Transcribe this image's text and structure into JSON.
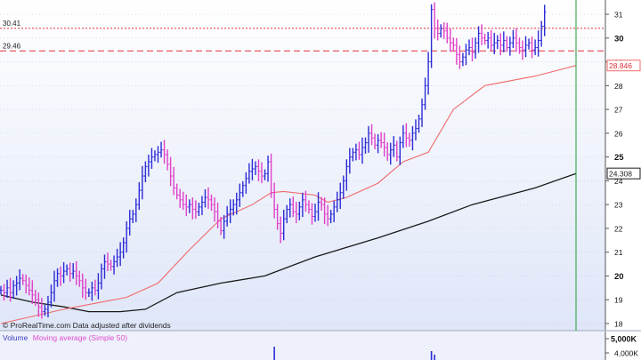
{
  "source_note": "© ProRealTime.com  Data adjusted after dividends",
  "volume_legend": {
    "volume_label": "Volume",
    "ma_label": "Moving average (Simple 50)"
  },
  "colors": {
    "bg_top": "#ffffff",
    "bg_bottom": "#dfe6f8",
    "up": "#2b2bd6",
    "down": "#e040c8",
    "ma50": "#f06a6a",
    "ma200": "#1a1a1a",
    "hline": "#e0303a",
    "cursor": "#1f9a36"
  },
  "chart_data": {
    "type": "candlestick",
    "ylim": [
      17.7,
      31.6
    ],
    "y_ticks": [
      "18",
      "19",
      "20",
      "21",
      "22",
      "23",
      "24",
      "25",
      "26",
      "27",
      "28",
      "29",
      "30",
      "31"
    ],
    "bold_ticks": [
      "20",
      "25",
      "30"
    ],
    "bar_count": 184,
    "ref_lines": [
      {
        "value": 30.41,
        "label": "30.41",
        "style": "dotted"
      },
      {
        "value": 29.46,
        "label": "29.46",
        "style": "dashed"
      }
    ],
    "price_tags": [
      {
        "value": 28.846,
        "label": "28.846",
        "series": "ma50"
      },
      {
        "value": 24.308,
        "label": "24.308",
        "series": "ma200"
      }
    ],
    "closes": [
      19.4,
      19.3,
      19.5,
      19.3,
      19.6,
      19.7,
      19.9,
      19.8,
      19.6,
      19.4,
      19.2,
      19.0,
      18.7,
      18.5,
      18.6,
      18.9,
      19.3,
      19.8,
      20.1,
      20.0,
      20.2,
      20.3,
      20.1,
      20.2,
      20.0,
      19.8,
      19.5,
      19.3,
      19.3,
      19.5,
      19.4,
      19.7,
      20.3,
      20.6,
      20.5,
      20.4,
      20.6,
      20.8,
      21.0,
      21.4,
      22.0,
      22.4,
      22.6,
      23.0,
      23.6,
      24.2,
      24.6,
      24.8,
      25.0,
      25.1,
      25.2,
      25.3,
      25.1,
      24.7,
      24.2,
      23.7,
      23.4,
      23.2,
      23.0,
      22.9,
      23.0,
      22.8,
      22.7,
      22.9,
      23.1,
      23.3,
      23.2,
      23.0,
      22.7,
      22.3,
      21.9,
      22.3,
      22.6,
      22.8,
      23.0,
      23.2,
      23.5,
      23.8,
      24.1,
      24.4,
      24.5,
      24.6,
      24.4,
      24.2,
      24.3,
      24.8,
      23.5,
      22.8,
      22.2,
      21.8,
      22.4,
      22.8,
      23.0,
      22.7,
      22.6,
      22.9,
      23.2,
      23.0,
      22.8,
      22.5,
      22.7,
      23.1,
      23.0,
      22.6,
      22.4,
      22.6,
      22.9,
      23.2,
      23.5,
      24.0,
      24.6,
      25.0,
      25.2,
      25.3,
      25.1,
      25.4,
      25.6,
      26.0,
      25.8,
      25.5,
      25.7,
      25.6,
      25.4,
      25.1,
      25.3,
      25.5,
      25.0,
      25.6,
      26.0,
      25.8,
      25.7,
      26.0,
      26.2,
      26.6,
      27.2,
      28.0,
      29.0,
      31.2,
      30.4,
      30.2,
      30.4,
      30.3,
      30.0,
      29.8,
      29.7,
      29.3,
      29.0,
      29.2,
      29.5,
      29.6,
      29.4,
      29.8,
      30.2,
      30.0,
      29.9,
      30.0,
      29.7,
      29.8,
      29.9,
      29.7,
      29.9,
      29.6,
      29.8,
      30.0,
      29.8,
      29.6,
      29.5,
      29.7,
      29.8,
      29.5,
      29.6,
      29.9,
      30.5,
      31.1
    ],
    "ma50": [
      [
        0,
        18.0
      ],
      [
        20,
        18.6
      ],
      [
        40,
        19.1
      ],
      [
        50,
        19.7
      ],
      [
        60,
        21.1
      ],
      [
        70,
        22.4
      ],
      [
        80,
        23.0
      ],
      [
        86,
        23.5
      ],
      [
        90,
        23.55
      ],
      [
        100,
        23.4
      ],
      [
        104,
        23.1
      ],
      [
        110,
        23.3
      ],
      [
        120,
        23.9
      ],
      [
        128,
        24.8
      ],
      [
        136,
        25.2
      ],
      [
        144,
        27.0
      ],
      [
        154,
        28.0
      ],
      [
        170,
        28.4
      ],
      [
        183,
        28.846
      ]
    ],
    "ma200": [
      [
        0,
        19.2
      ],
      [
        10,
        18.9
      ],
      [
        20,
        18.7
      ],
      [
        28,
        18.5
      ],
      [
        38,
        18.5
      ],
      [
        46,
        18.6
      ],
      [
        56,
        19.3
      ],
      [
        70,
        19.7
      ],
      [
        84,
        20.0
      ],
      [
        100,
        20.8
      ],
      [
        120,
        21.6
      ],
      [
        136,
        22.3
      ],
      [
        150,
        23.0
      ],
      [
        170,
        23.7
      ],
      [
        183,
        24.308
      ]
    ],
    "volume_ticks": [
      "5,000K",
      "4,000K"
    ]
  }
}
